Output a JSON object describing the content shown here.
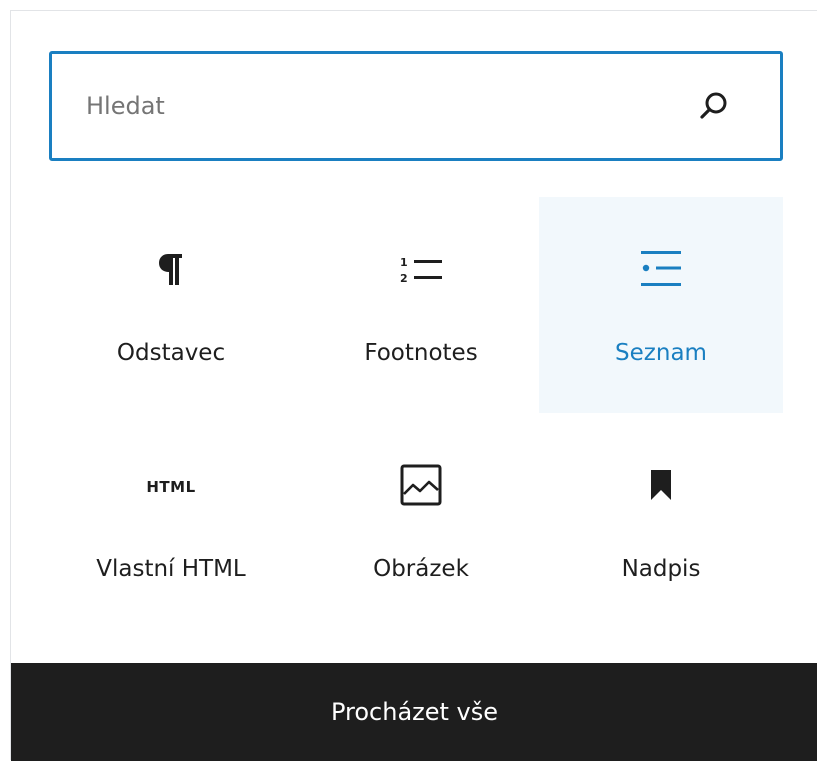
{
  "search": {
    "placeholder": "Hledat",
    "icon": "search-icon"
  },
  "blocks": [
    {
      "label": "Odstavec",
      "icon": "paragraph-icon",
      "active": false
    },
    {
      "label": "Footnotes",
      "icon": "numbered-list-icon",
      "active": false
    },
    {
      "label": "Seznam",
      "icon": "bulleted-list-icon",
      "active": true
    },
    {
      "label": "Vlastní HTML",
      "icon": "html-icon",
      "icon_text": "HTML",
      "active": false
    },
    {
      "label": "Obrázek",
      "icon": "image-icon",
      "active": false
    },
    {
      "label": "Nadpis",
      "icon": "bookmark-icon",
      "active": false
    }
  ],
  "footer": {
    "browse_all_label": "Procházet vše"
  },
  "colors": {
    "accent": "#1a7fc1",
    "highlight_bg": "#f2f8fc",
    "text": "#1e1e1e",
    "footer_bg": "#1e1e1e",
    "placeholder": "#757575"
  }
}
